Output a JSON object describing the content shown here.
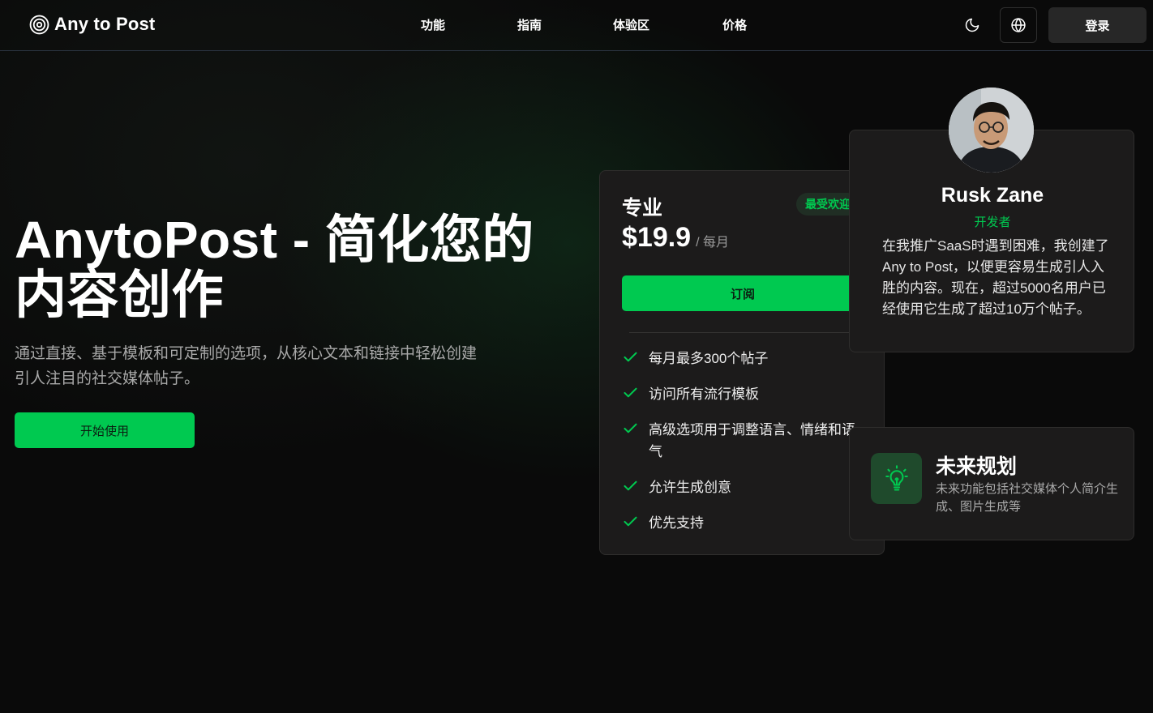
{
  "brand": {
    "name": "Any to Post",
    "logo_icon": "target-icon"
  },
  "nav": {
    "items": [
      "功能",
      "指南",
      "体验区",
      "价格"
    ]
  },
  "header": {
    "theme_icon": "moon-icon",
    "language_icon": "globe-icon",
    "login_label": "登录"
  },
  "hero": {
    "title": "AnytoPost - 简化您的内容创作",
    "description": "通过直接、基于模板和可定制的选项，从核心文本和链接中轻松创建引人注目的社交媒体帖子。",
    "cta_label": "开始使用"
  },
  "pricing": {
    "plan_name": "专业",
    "badge": "最受欢迎",
    "price": "$19.9",
    "period": "/ 每月",
    "subscribe_label": "订阅",
    "features": [
      "每月最多300个帖子",
      "访问所有流行模板",
      "高级选项用于调整语言、情绪和语气",
      "允许生成创意",
      "优先支持"
    ]
  },
  "testimonial": {
    "name": "Rusk Zane",
    "role": "开发者",
    "quote": "在我推广SaaS时遇到困难，我创建了Any to Post，以便更容易生成引人入胜的内容。现在，超过5000名用户已经使用它生成了超过10万个帖子。"
  },
  "roadmap": {
    "icon": "lightbulb-icon",
    "title": "未来规划",
    "description": "未来功能包括社交媒体个人简介生成、图片生成等"
  },
  "colors": {
    "accent": "#00c950",
    "background": "#0a0a0a",
    "card": "#1c1b1b"
  }
}
